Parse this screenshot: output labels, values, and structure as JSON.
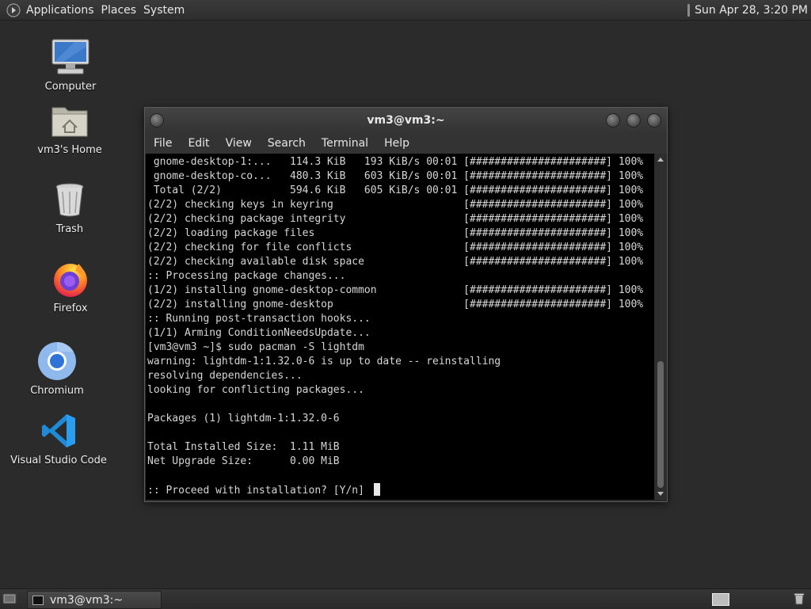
{
  "top_panel": {
    "menus": [
      "Applications",
      "Places",
      "System"
    ],
    "clock": "Sun Apr 28,  3:20 PM"
  },
  "desktop": {
    "icons": [
      {
        "label": "Computer",
        "icon": "computer-icon"
      },
      {
        "label": "vm3's Home",
        "icon": "home-folder-icon"
      },
      {
        "label": "Trash",
        "icon": "trash-icon"
      },
      {
        "label": "Firefox",
        "icon": "firefox-icon"
      },
      {
        "label": "Chromium",
        "icon": "chromium-icon"
      },
      {
        "label": "Visual Studio Code",
        "icon": "vscode-icon"
      }
    ]
  },
  "terminal": {
    "title": "vm3@vm3:~",
    "menu": [
      "File",
      "Edit",
      "View",
      "Search",
      "Terminal",
      "Help"
    ],
    "lines": [
      " gnome-desktop-1:...   114.3 KiB   193 KiB/s 00:01 [######################] 100%",
      " gnome-desktop-co...   480.3 KiB   603 KiB/s 00:01 [######################] 100%",
      " Total (2/2)           594.6 KiB   605 KiB/s 00:01 [######################] 100%",
      "(2/2) checking keys in keyring                     [######################] 100%",
      "(2/2) checking package integrity                   [######################] 100%",
      "(2/2) loading package files                        [######################] 100%",
      "(2/2) checking for file conflicts                  [######################] 100%",
      "(2/2) checking available disk space                [######################] 100%",
      ":: Processing package changes...",
      "(1/2) installing gnome-desktop-common              [######################] 100%",
      "(2/2) installing gnome-desktop                     [######################] 100%",
      ":: Running post-transaction hooks...",
      "(1/1) Arming ConditionNeedsUpdate...",
      "[vm3@vm3 ~]$ sudo pacman -S lightdm",
      "warning: lightdm-1:1.32.0-6 is up to date -- reinstalling",
      "resolving dependencies...",
      "looking for conflicting packages...",
      "",
      "Packages (1) lightdm-1:1.32.0-6",
      "",
      "Total Installed Size:  1.11 MiB",
      "Net Upgrade Size:      0.00 MiB",
      "",
      ":: Proceed with installation? [Y/n] "
    ]
  },
  "taskbar": {
    "window_button": "vm3@vm3:~"
  }
}
